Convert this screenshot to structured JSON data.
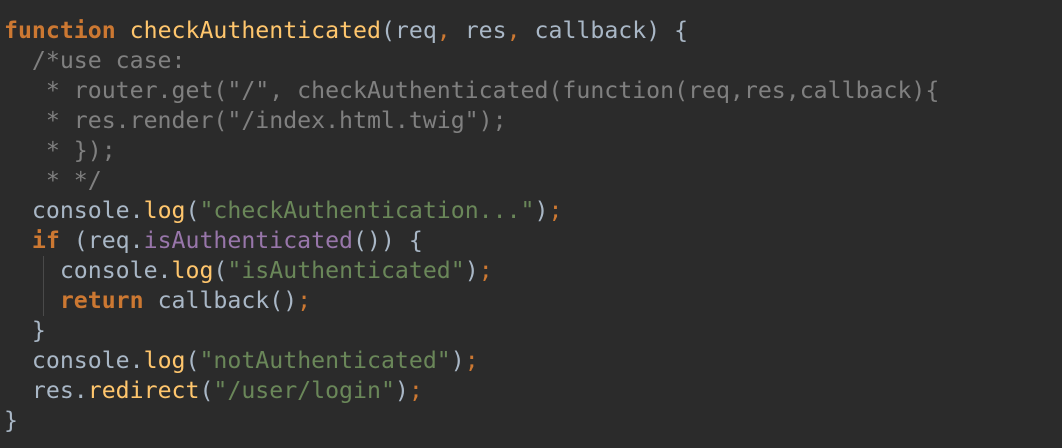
{
  "editor": {
    "lines": [
      [
        {
          "t": "function",
          "c": "kw"
        },
        {
          "t": " ",
          "c": "plain"
        },
        {
          "t": "checkAuthenticated",
          "c": "fn"
        },
        {
          "t": "(",
          "c": "plain"
        },
        {
          "t": "req",
          "c": "pm"
        },
        {
          "t": ", ",
          "c": "punc"
        },
        {
          "t": "res",
          "c": "pm"
        },
        {
          "t": ", ",
          "c": "punc"
        },
        {
          "t": "callback",
          "c": "pm"
        },
        {
          "t": ") {",
          "c": "plain"
        }
      ],
      [
        {
          "t": "  /*use case:",
          "c": "cm"
        }
      ],
      [
        {
          "t": "   * router.get(\"/\", checkAuthenticated(function(req,res,callback){",
          "c": "cm"
        }
      ],
      [
        {
          "t": "   * res.render(\"/index.html.twig\");",
          "c": "cm"
        }
      ],
      [
        {
          "t": "   * });",
          "c": "cm"
        }
      ],
      [
        {
          "t": "   * */",
          "c": "cm"
        }
      ],
      [
        {
          "t": "  console.",
          "c": "plain"
        },
        {
          "t": "log",
          "c": "fn"
        },
        {
          "t": "(",
          "c": "plain"
        },
        {
          "t": "\"checkAuthentication...\"",
          "c": "str"
        },
        {
          "t": ")",
          "c": "plain"
        },
        {
          "t": ";",
          "c": "punc"
        }
      ],
      [
        {
          "t": "  ",
          "c": "plain"
        },
        {
          "t": "if",
          "c": "kw"
        },
        {
          "t": " (req.",
          "c": "plain"
        },
        {
          "t": "isAuthenticated",
          "c": "pr"
        },
        {
          "t": "()) {",
          "c": "plain"
        }
      ],
      [
        {
          "t": "    console.",
          "c": "plain"
        },
        {
          "t": "log",
          "c": "fn"
        },
        {
          "t": "(",
          "c": "plain"
        },
        {
          "t": "\"isAuthenticated\"",
          "c": "str"
        },
        {
          "t": ")",
          "c": "plain"
        },
        {
          "t": ";",
          "c": "punc"
        }
      ],
      [
        {
          "t": "    ",
          "c": "plain"
        },
        {
          "t": "return",
          "c": "kw"
        },
        {
          "t": " callback()",
          "c": "plain"
        },
        {
          "t": ";",
          "c": "punc"
        }
      ],
      [
        {
          "t": "  }",
          "c": "plain"
        }
      ],
      [
        {
          "t": "  console.",
          "c": "plain"
        },
        {
          "t": "log",
          "c": "fn"
        },
        {
          "t": "(",
          "c": "plain"
        },
        {
          "t": "\"notAuthenticated\"",
          "c": "str"
        },
        {
          "t": ")",
          "c": "plain"
        },
        {
          "t": ";",
          "c": "punc"
        }
      ],
      [
        {
          "t": "  res.",
          "c": "plain"
        },
        {
          "t": "redirect",
          "c": "fn"
        },
        {
          "t": "(",
          "c": "plain"
        },
        {
          "t": "\"/user/login\"",
          "c": "str"
        },
        {
          "t": ")",
          "c": "plain"
        },
        {
          "t": ";",
          "c": "punc"
        }
      ],
      [
        {
          "t": "}",
          "c": "plain"
        }
      ]
    ]
  }
}
